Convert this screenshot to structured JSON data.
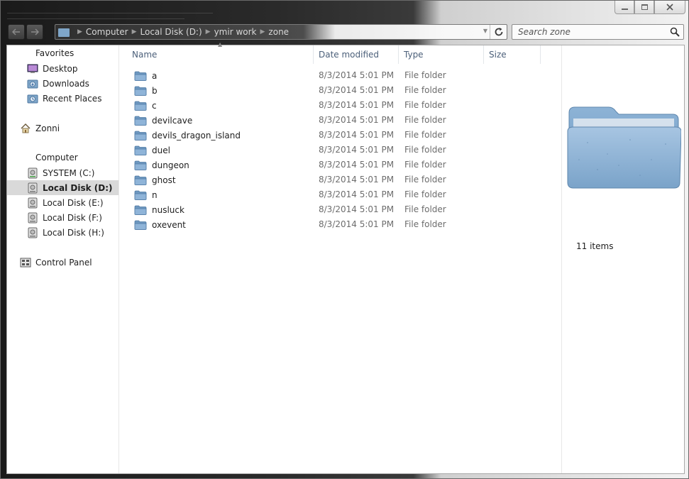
{
  "address": {
    "crumbs": [
      "Computer",
      "Local Disk (D:)",
      "ymir work",
      "zone"
    ]
  },
  "search": {
    "placeholder": "Search zone"
  },
  "nav": {
    "favorites_header": "Favorites",
    "favorites": [
      {
        "label": "Desktop",
        "icon": "desktop-icon"
      },
      {
        "label": "Downloads",
        "icon": "downloads-icon"
      },
      {
        "label": "Recent Places",
        "icon": "recent-places-icon"
      }
    ],
    "user": {
      "label": "Zonni",
      "icon": "home-icon"
    },
    "computer_header": "Computer",
    "drives": [
      {
        "label": "SYSTEM (C:)",
        "selected": false
      },
      {
        "label": "Local Disk (D:)",
        "selected": true
      },
      {
        "label": "Local Disk (E:)",
        "selected": false
      },
      {
        "label": "Local Disk (F:)",
        "selected": false
      },
      {
        "label": "Local Disk (H:)",
        "selected": false
      }
    ],
    "control_panel": {
      "label": "Control Panel",
      "icon": "control-panel-icon"
    }
  },
  "columns": {
    "name": "Name",
    "date_modified": "Date modified",
    "type": "Type",
    "size": "Size"
  },
  "files": [
    {
      "name": "a",
      "date": "8/3/2014 5:01 PM",
      "type": "File folder"
    },
    {
      "name": "b",
      "date": "8/3/2014 5:01 PM",
      "type": "File folder"
    },
    {
      "name": "c",
      "date": "8/3/2014 5:01 PM",
      "type": "File folder"
    },
    {
      "name": "devilcave",
      "date": "8/3/2014 5:01 PM",
      "type": "File folder"
    },
    {
      "name": "devils_dragon_island",
      "date": "8/3/2014 5:01 PM",
      "type": "File folder"
    },
    {
      "name": "duel",
      "date": "8/3/2014 5:01 PM",
      "type": "File folder"
    },
    {
      "name": "dungeon",
      "date": "8/3/2014 5:01 PM",
      "type": "File folder"
    },
    {
      "name": "ghost",
      "date": "8/3/2014 5:01 PM",
      "type": "File folder"
    },
    {
      "name": "n",
      "date": "8/3/2014 5:01 PM",
      "type": "File folder"
    },
    {
      "name": "nusluck",
      "date": "8/3/2014 5:01 PM",
      "type": "File folder"
    },
    {
      "name": "oxevent",
      "date": "8/3/2014 5:01 PM",
      "type": "File folder"
    }
  ],
  "preview": {
    "item_count": "11 items"
  },
  "colors": {
    "folder_blue": "#7fa6c9",
    "selected_bg": "#d9d9d9",
    "header_text": "#4c607a"
  }
}
